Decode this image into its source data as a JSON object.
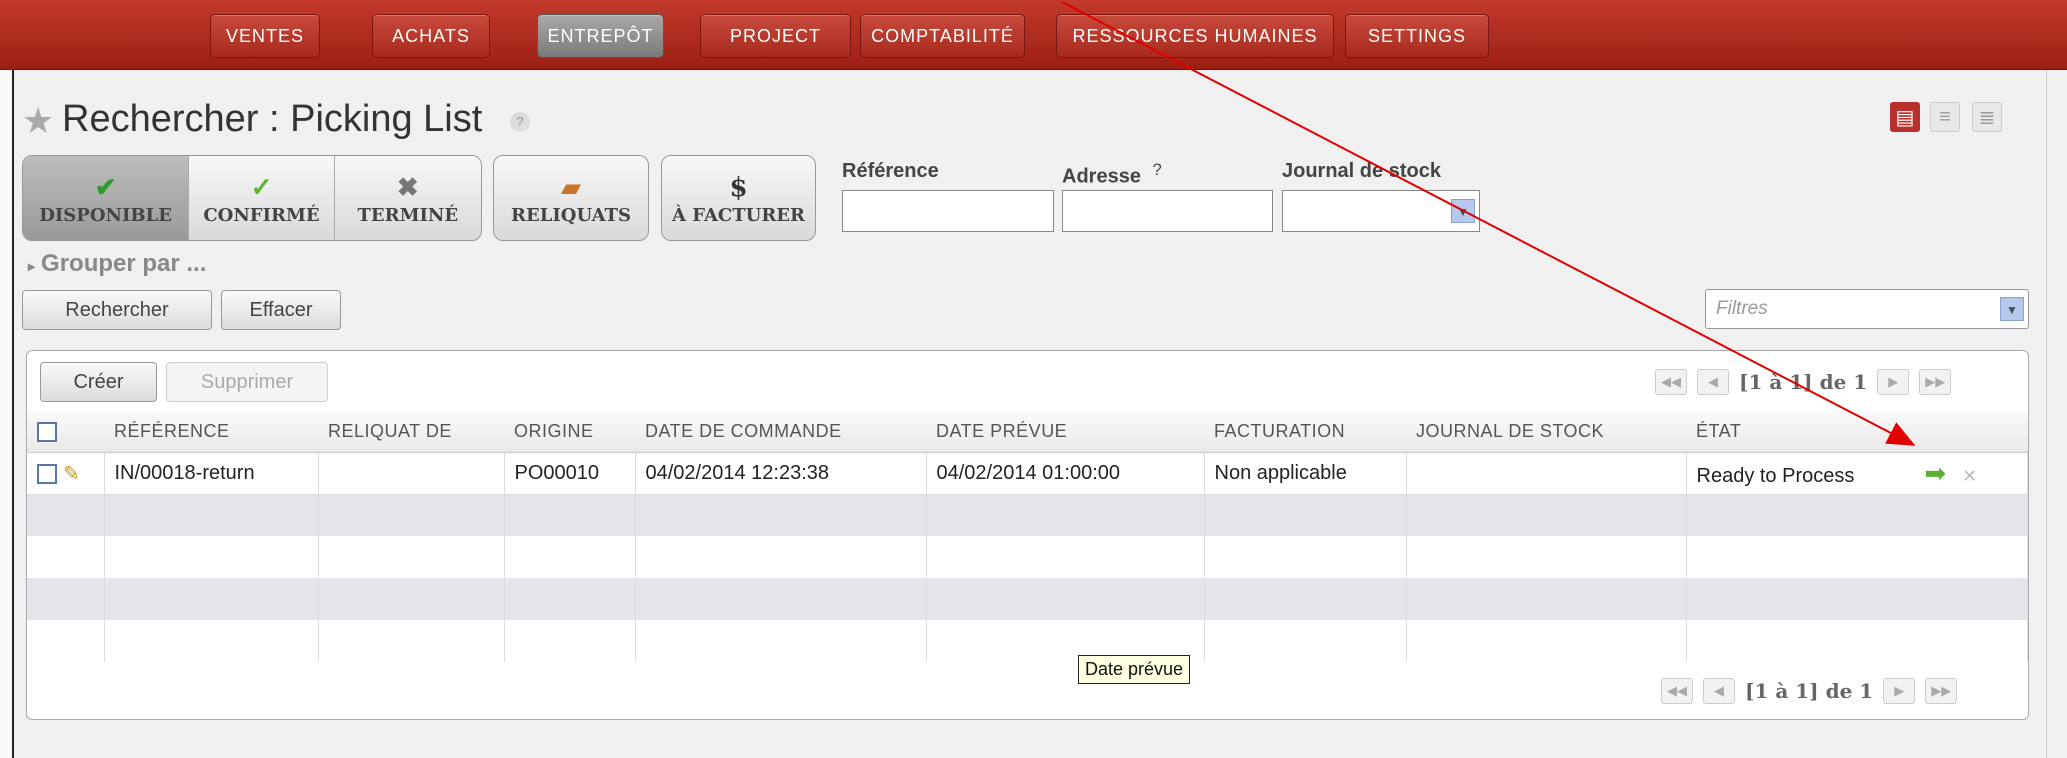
{
  "nav": {
    "items": [
      {
        "label": "VENTES"
      },
      {
        "label": "ACHATS"
      },
      {
        "label": "ENTREPÔT"
      },
      {
        "label": "PROJECT"
      },
      {
        "label": "COMPTABILITÉ"
      },
      {
        "label": "RESSOURCES HUMAINES"
      },
      {
        "label": "SETTINGS"
      }
    ],
    "active": "ENTREPÔT"
  },
  "page": {
    "title": "Rechercher : Picking List",
    "help": "?"
  },
  "filters": {
    "buttons": [
      {
        "label": "DISPONIBLE",
        "icon": "check-circle-icon",
        "active": true
      },
      {
        "label": "CONFIRMÉ",
        "icon": "checkmark-icon",
        "active": false
      },
      {
        "label": "TERMINÉ",
        "icon": "cross-icon",
        "active": false
      },
      {
        "label": "RELIQUATS",
        "icon": "box-icon"
      },
      {
        "label": "À FACTURER",
        "icon": "dollar-icon",
        "icon_text": "$"
      }
    ],
    "fields": {
      "reference_label": "Référence",
      "adresse_label": "Adresse",
      "adresse_help": "?",
      "journal_label": "Journal de stock"
    },
    "group_by": "Grouper par ...",
    "search_button": "Rechercher",
    "clear_button": "Effacer",
    "filters_placeholder": "Filtres"
  },
  "list": {
    "create_button": "Créer",
    "delete_button": "Supprimer",
    "pager_text": "[1 à 1] de 1",
    "columns": [
      "RÉFÉRENCE",
      "RELIQUAT DE",
      "ORIGINE",
      "DATE DE COMMANDE",
      "DATE PRÉVUE",
      "FACTURATION",
      "JOURNAL DE STOCK",
      "ÉTAT"
    ],
    "rows": [
      {
        "reference": "IN/00018-return",
        "reliquat": "",
        "origine": "PO00010",
        "date_commande": "04/02/2014 12:23:38",
        "date_prevue": "04/02/2014 01:00:00",
        "facturation": "Non applicable",
        "journal": "",
        "etat": "Ready to Process"
      }
    ]
  },
  "tooltip": "Date prévue",
  "colors": {
    "nav_bg": "#b02d21",
    "active_view": "#b8302c",
    "annotation": "#e00000",
    "go_arrow": "#5bb12f"
  }
}
